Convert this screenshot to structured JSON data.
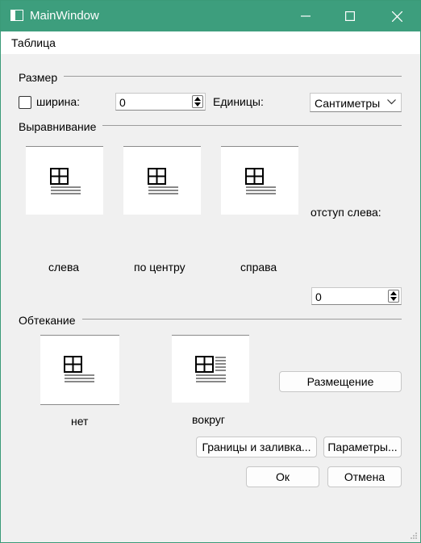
{
  "window": {
    "title": "MainWindow",
    "controls": {
      "minimize": "minimize-icon",
      "maximize": "maximize-icon",
      "close": "close-icon"
    }
  },
  "menu": {
    "items": [
      "Таблица"
    ]
  },
  "size_section": {
    "title": "Размер",
    "width_checkbox_label": "ширина:",
    "width_checked": false,
    "width_value": "0",
    "units_label": "Единицы:",
    "units_value": "Сантиметры"
  },
  "alignment_section": {
    "title": "Выравнивание",
    "options": [
      "слева",
      "по центру",
      "справа"
    ],
    "indent_label": "отступ слева:",
    "indent_value": "0"
  },
  "wrap_section": {
    "title": "Обтекание",
    "options": [
      "нет",
      "вокруг"
    ],
    "placement_button": "Размещение"
  },
  "buttons": {
    "borders": "Границы и заливка...",
    "params": "Параметры...",
    "ok": "Ок",
    "cancel": "Отмена"
  },
  "colors": {
    "titlebar": "#3d9e7d",
    "background": "#f0f0f0"
  }
}
